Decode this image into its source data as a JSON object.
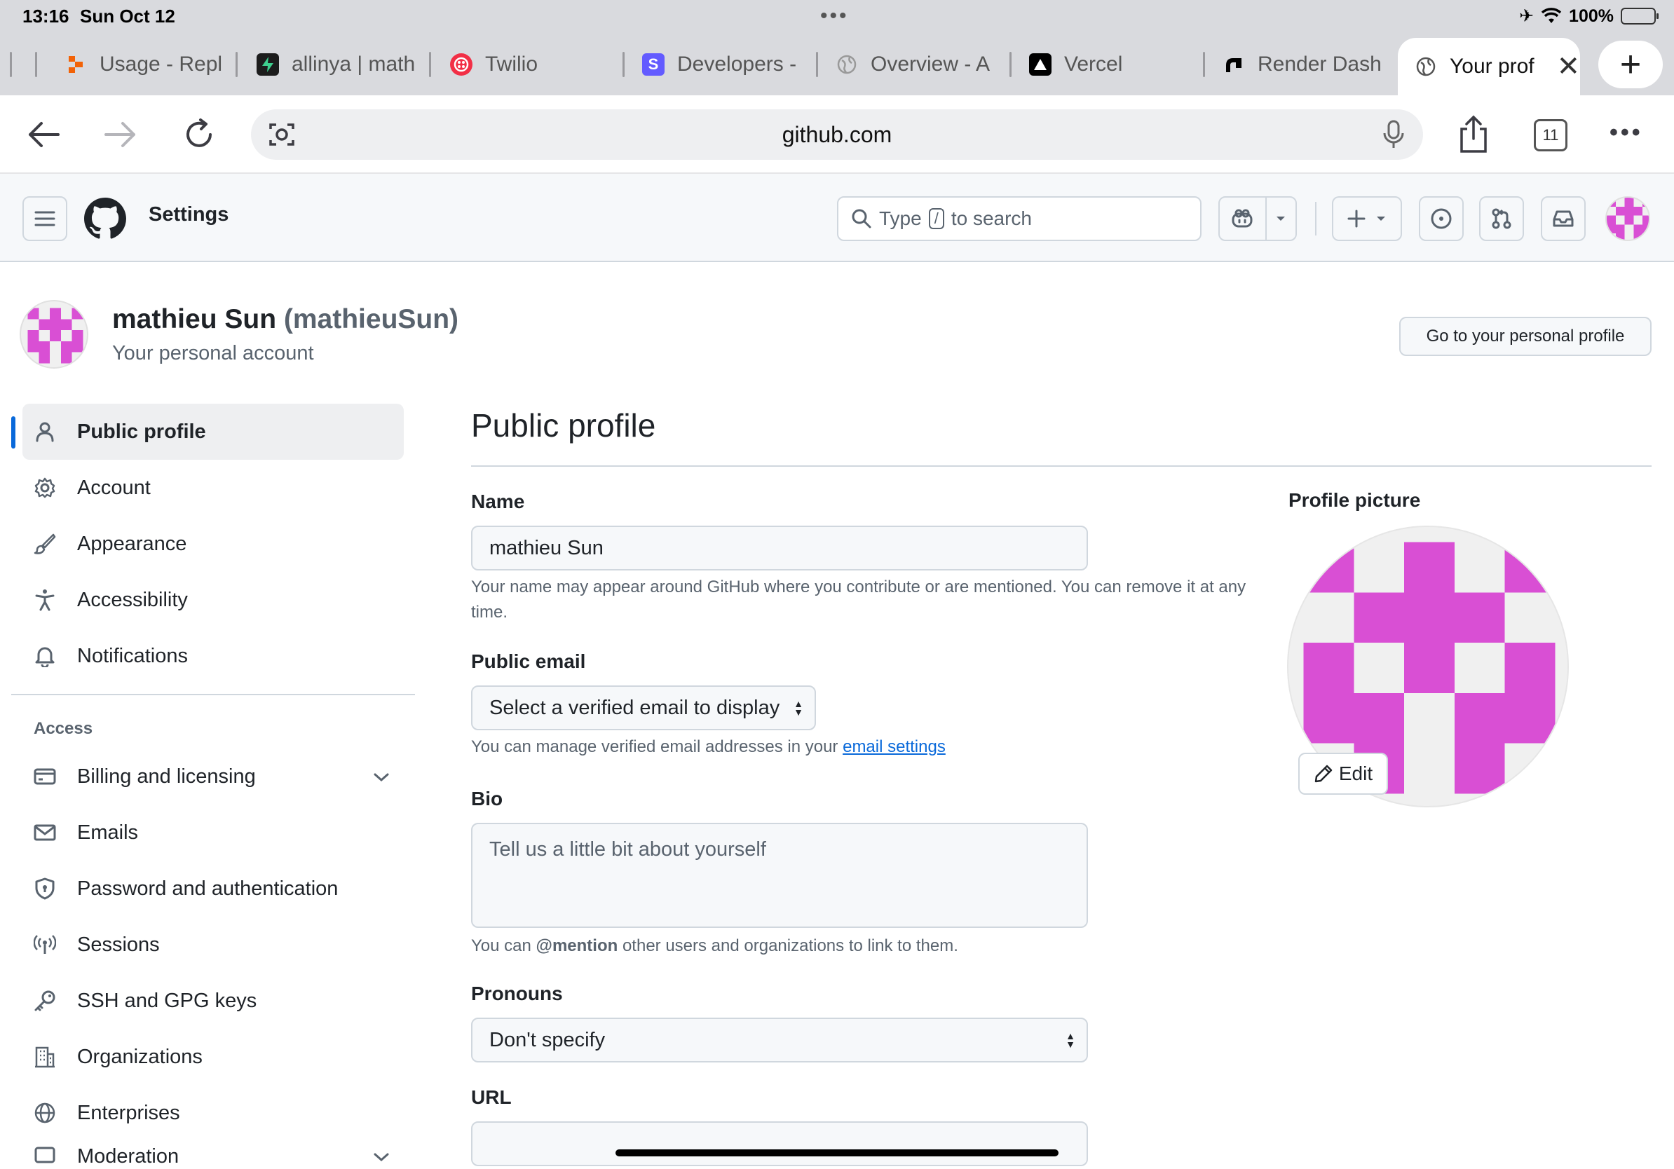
{
  "status_bar": {
    "time": "13:16",
    "date": "Sun Oct 12",
    "battery": "100%"
  },
  "tabs": [
    {
      "label": "Usage - Repl",
      "icon": "replit-icon"
    },
    {
      "label": "allinya | math",
      "icon": "supabase-icon"
    },
    {
      "label": "Twilio",
      "icon": "twilio-icon"
    },
    {
      "label": "Developers -",
      "icon": "stripe-icon"
    },
    {
      "label": "Overview - A",
      "icon": "globe-icon"
    },
    {
      "label": "Vercel",
      "icon": "vercel-icon"
    },
    {
      "label": "Render Dash",
      "icon": "render-icon"
    },
    {
      "label": "Your prof",
      "icon": "globe-icon",
      "active": true
    }
  ],
  "browser": {
    "url": "github.com",
    "tab_count": "11"
  },
  "header": {
    "title": "Settings",
    "search_prefix": "Type",
    "search_key": "/",
    "search_suffix": "to search"
  },
  "account": {
    "name": "mathieu Sun",
    "handle": "(mathieuSun)",
    "subtitle": "Your personal account",
    "goto_profile": "Go to your personal profile"
  },
  "sidebar": {
    "items": [
      {
        "label": "Public profile",
        "icon": "person-icon"
      },
      {
        "label": "Account",
        "icon": "gear-icon"
      },
      {
        "label": "Appearance",
        "icon": "paintbrush-icon"
      },
      {
        "label": "Accessibility",
        "icon": "accessibility-icon"
      },
      {
        "label": "Notifications",
        "icon": "bell-icon"
      }
    ],
    "group_label": "Access",
    "access_items": [
      {
        "label": "Billing and licensing",
        "icon": "credit-card-icon"
      },
      {
        "label": "Emails",
        "icon": "mail-icon"
      },
      {
        "label": "Password and authentication",
        "icon": "shield-lock-icon"
      },
      {
        "label": "Sessions",
        "icon": "broadcast-icon"
      },
      {
        "label": "SSH and GPG keys",
        "icon": "key-icon"
      },
      {
        "label": "Organizations",
        "icon": "organization-icon"
      },
      {
        "label": "Enterprises",
        "icon": "globe-icon"
      },
      {
        "label": "Moderation",
        "icon": "report-icon"
      }
    ]
  },
  "main": {
    "title": "Public profile",
    "name_label": "Name",
    "name_value": "mathieu Sun",
    "name_hint": "Your name may appear around GitHub where you contribute or are mentioned. You can remove it at any time.",
    "email_label": "Public email",
    "email_select": "Select a verified email to display",
    "email_hint_prefix": "You can manage verified email addresses in your",
    "email_hint_link": "email settings",
    "bio_label": "Bio",
    "bio_placeholder": "Tell us a little bit about yourself",
    "bio_hint_prefix": "You can",
    "bio_hint_mention": "@mention",
    "bio_hint_suffix": "other users and organizations to link to them.",
    "pronouns_label": "Pronouns",
    "pronouns_value": "Don't specify",
    "url_label": "URL",
    "url_value": "",
    "picture_label": "Profile picture",
    "edit_label": "Edit"
  },
  "colors": {
    "accent": "#0969da",
    "identicon": "#d94fd4",
    "identicon_bg": "#f0f0f0"
  }
}
